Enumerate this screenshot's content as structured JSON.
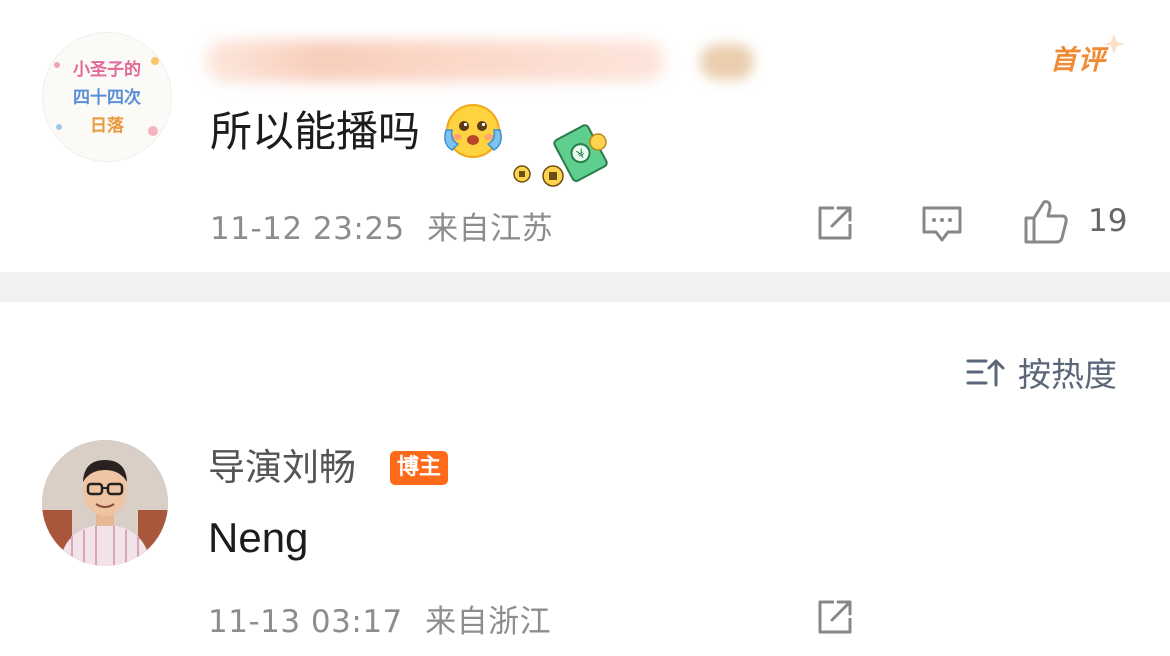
{
  "comment1": {
    "avatar_text": [
      "小圣子的",
      "四十四次",
      "日落"
    ],
    "first_badge": "首评",
    "text": "所以能播吗",
    "time": "11-12 23:25",
    "location": "来自江苏",
    "like_count": "19"
  },
  "sort": {
    "label": "按热度"
  },
  "comment2": {
    "name": "导演刘畅",
    "badge": "博主",
    "text": "Neng",
    "time": "11-13 03:17",
    "location": "来自浙江"
  },
  "colors": {
    "accent_orange": "#f08a33",
    "badge_orange": "#ff6a1a",
    "meta_gray": "#8d8d8d",
    "divider": "#f1f1f1"
  }
}
